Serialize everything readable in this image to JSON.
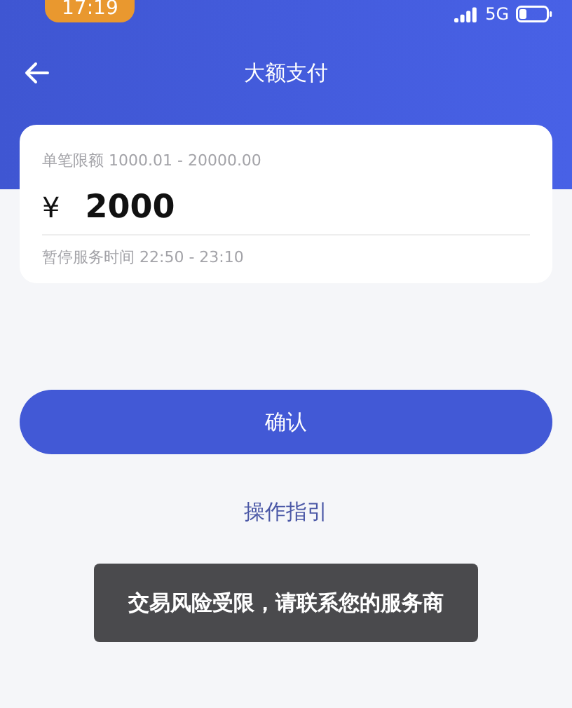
{
  "status_bar": {
    "time": "17:19",
    "network": "5G"
  },
  "nav": {
    "title": "大额支付"
  },
  "amount_card": {
    "limit_label": "单笔限额 1000.01 - 20000.00",
    "currency": "¥",
    "amount": "2000",
    "note": "暂停服务时间 22:50 - 23:10"
  },
  "confirm_button": "确认",
  "guide_link": "操作指引",
  "toast": "交易风险受限，请联系您的服务商"
}
